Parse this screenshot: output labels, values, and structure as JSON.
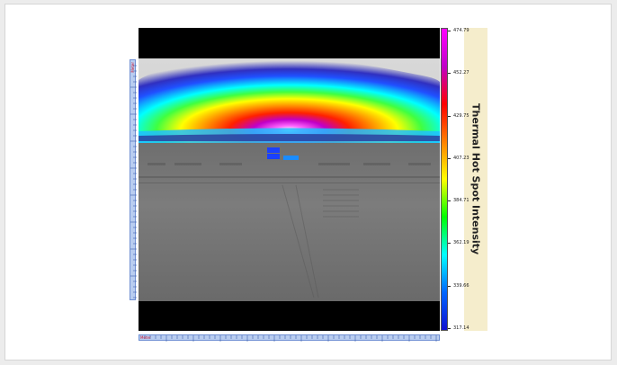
{
  "colorbar": {
    "title": "Thermal Hot Spot Intensity",
    "labels": [
      "474.79",
      "452.27",
      "429.75",
      "407.23",
      "384.71",
      "362.19",
      "339.66",
      "317.14"
    ],
    "gradient": [
      "#ff00ff",
      "#c000c8",
      "#ff0000",
      "#ff8000",
      "#ffff00",
      "#00ff00",
      "#00ffff",
      "#0066ff",
      "#1010d0"
    ]
  },
  "rulers": {
    "vertical_label": "Meter",
    "horizontal_label": "Meter"
  }
}
